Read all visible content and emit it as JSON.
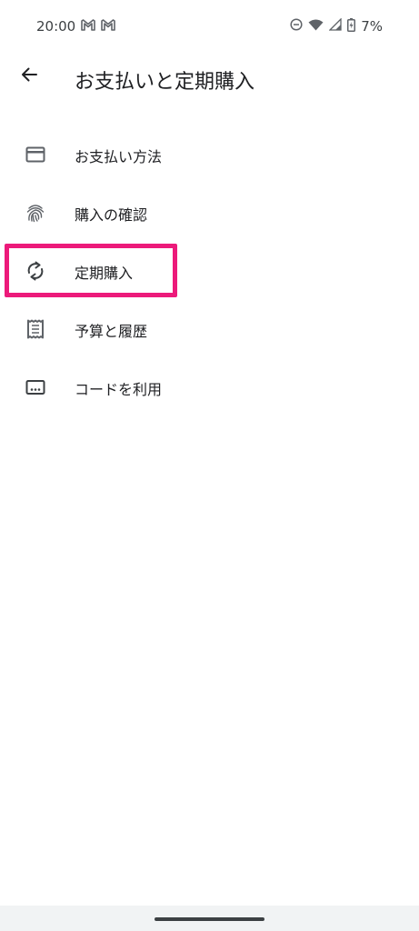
{
  "status_bar": {
    "time": "20:00",
    "battery_percent": "7%",
    "left_icons": [
      "gmail-icon",
      "gmail-icon"
    ],
    "right_icons": [
      "do-not-disturb-icon",
      "wifi-icon",
      "signal-icon",
      "battery-icon"
    ]
  },
  "header": {
    "title": "お支払いと定期購入"
  },
  "menu": {
    "items": [
      {
        "label": "お支払い方法",
        "icon": "credit-card-icon"
      },
      {
        "label": "購入の確認",
        "icon": "fingerprint-icon"
      },
      {
        "label": "定期購入",
        "icon": "sync-icon",
        "highlighted": true
      },
      {
        "label": "予算と履歴",
        "icon": "receipt-icon"
      },
      {
        "label": "コードを利用",
        "icon": "redeem-code-icon"
      }
    ]
  },
  "colors": {
    "highlight": "#ec1a7a",
    "icon": "#5f6368",
    "text": "#202124"
  }
}
